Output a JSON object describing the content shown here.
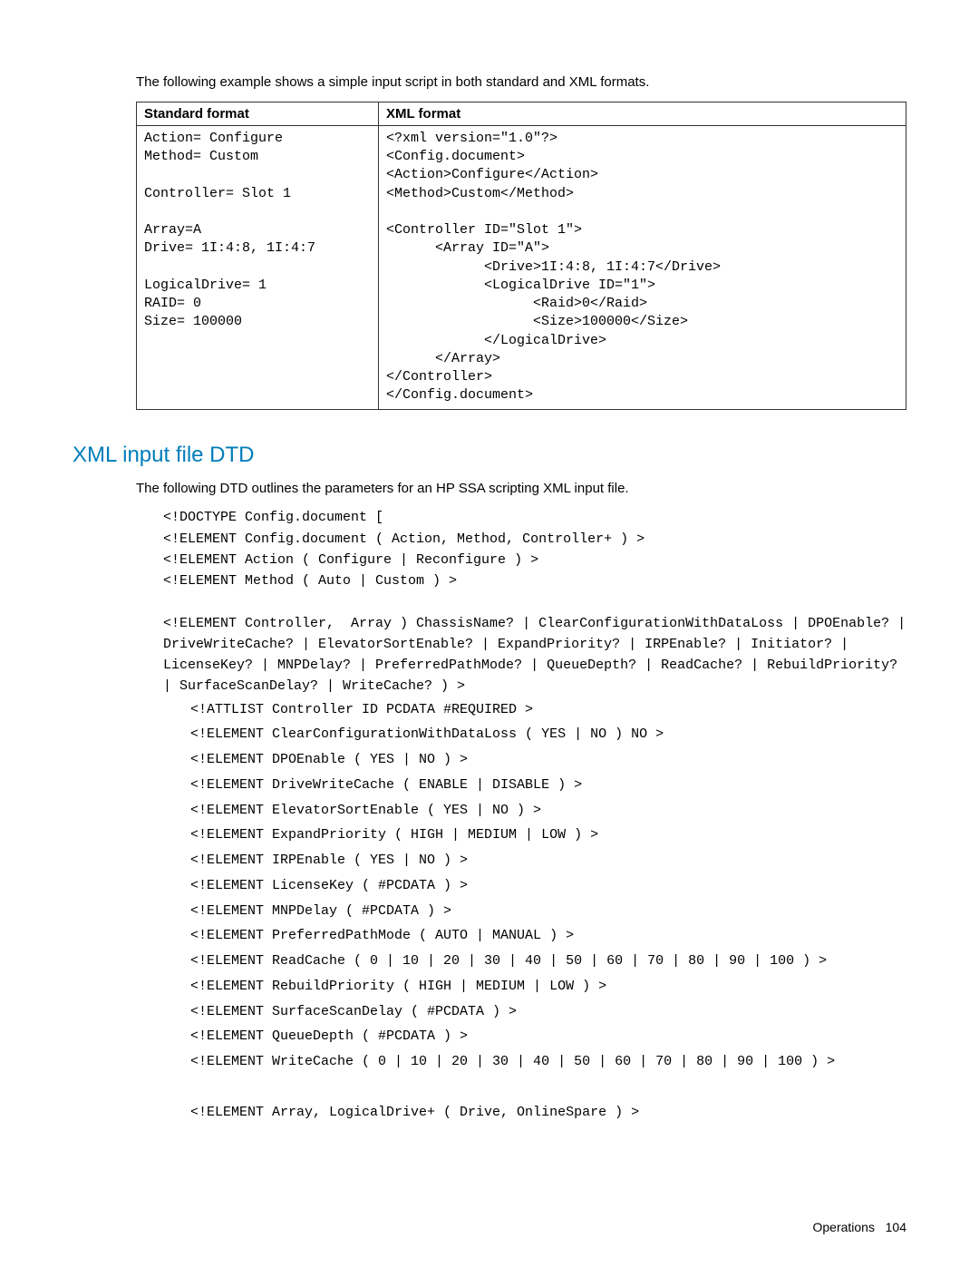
{
  "intro_text": "The following example shows a simple input script in both standard and XML formats.",
  "table": {
    "header_standard": "Standard format",
    "header_xml": "XML format",
    "standard_cell": "Action= Configure\nMethod= Custom\n\nController= Slot 1\n\nArray=A\nDrive= 1I:4:8, 1I:4:7\n\nLogicalDrive= 1\nRAID= 0\nSize= 100000",
    "xml_cell": "<?xml version=\"1.0\"?>\n<Config.document>\n<Action>Configure</Action>\n<Method>Custom</Method>\n\n<Controller ID=\"Slot 1\">\n      <Array ID=\"A\">\n            <Drive>1I:4:8, 1I:4:7</Drive>\n            <LogicalDrive ID=\"1\">\n                  <Raid>0</Raid>\n                  <Size>100000</Size>\n            </LogicalDrive>\n      </Array>\n</Controller>\n</Config.document>"
  },
  "section": {
    "title": "XML input file DTD",
    "lead": "The following DTD outlines the parameters for an HP SSA scripting XML input file."
  },
  "dtd_block1": "<!DOCTYPE Config.document [\n<!ELEMENT Config.document ( Action, Method, Controller+ ) >\n<!ELEMENT Action ( Configure | Reconfigure ) >\n<!ELEMENT Method ( Auto | Custom ) >\n\n<!ELEMENT Controller,  Array ) ChassisName? | ClearConfigurationWithDataLoss | DPOEnable? | DriveWriteCache? | ElevatorSortEnable? | ExpandPriority? | IRPEnable? | Initiator? | LicenseKey? | MNPDelay? | PreferredPathMode? | QueueDepth? | ReadCache? | RebuildPriority? | SurfaceScanDelay? | WriteCache? ) >",
  "dtd_indented": [
    "<!ATTLIST Controller ID PCDATA #REQUIRED >",
    "<!ELEMENT ClearConfigurationWithDataLoss ( YES | NO ) NO >",
    "<!ELEMENT DPOEnable ( YES | NO ) >",
    "<!ELEMENT DriveWriteCache ( ENABLE | DISABLE ) >",
    "<!ELEMENT ElevatorSortEnable ( YES | NO ) >",
    "<!ELEMENT ExpandPriority ( HIGH | MEDIUM | LOW ) >",
    "<!ELEMENT IRPEnable ( YES | NO ) >",
    "<!ELEMENT LicenseKey ( #PCDATA ) >",
    "<!ELEMENT MNPDelay ( #PCDATA ) >",
    "<!ELEMENT PreferredPathMode ( AUTO | MANUAL ) >",
    "<!ELEMENT ReadCache ( 0 | 10 | 20 | 30 | 40 | 50 | 60 | 70 | 80 | 90 | 100 ) >",
    "<!ELEMENT RebuildPriority ( HIGH | MEDIUM | LOW ) >",
    "<!ELEMENT SurfaceScanDelay ( #PCDATA ) >",
    "<!ELEMENT QueueDepth ( #PCDATA ) >",
    "<!ELEMENT WriteCache ( 0 | 10 | 20 | 30 | 40 | 50 | 60 | 70 | 80 | 90 | 100 ) >",
    "",
    "<!ELEMENT Array, LogicalDrive+ ( Drive, OnlineSpare ) >"
  ],
  "footer": {
    "section": "Operations",
    "page": "104"
  }
}
